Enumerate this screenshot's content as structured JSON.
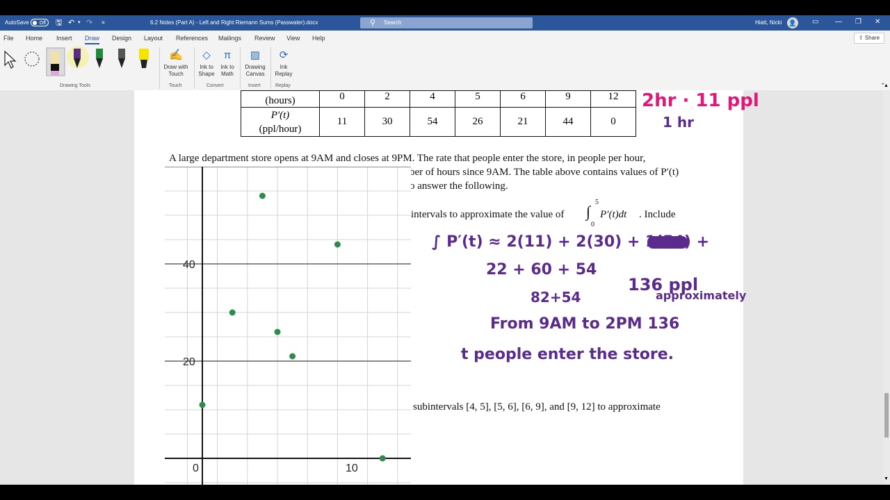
{
  "titlebar": {
    "autosave_label": "AutoSave",
    "autosave_state": "Off",
    "doc_title": "6.2 Notes (Part A) - Left and Right Riemann Sums (Passwater).docx",
    "search_placeholder": "Search",
    "user_name": "Hiatt, Nicki"
  },
  "menu": {
    "tabs": [
      "File",
      "Home",
      "Insert",
      "Draw",
      "Design",
      "Layout",
      "References",
      "Mailings",
      "Review",
      "View",
      "Help"
    ],
    "share": "Share"
  },
  "ribbon": {
    "draw_with_touch": "Draw with Touch",
    "ink_to_shape": "Ink to Shape",
    "ink_to_math": "Ink to Math",
    "drawing_canvas": "Drawing Canvas",
    "ink_replay": "Ink Replay",
    "groups": {
      "drawing_tools": "Drawing Tools",
      "touch": "Touch",
      "convert": "Convert",
      "insert": "Insert",
      "replay": "Replay"
    },
    "pen_colors": [
      "#111111",
      "#5b2a86",
      "#1f8a3a",
      "#333333",
      "#f5e400"
    ]
  },
  "table": {
    "row1_label": "(hours)",
    "row1_values": [
      "0",
      "2",
      "4",
      "5",
      "6",
      "9",
      "12"
    ],
    "row2_label_top": "P′(t)",
    "row2_label_bottom": "(ppl/hour)",
    "row2_values": [
      "11",
      "30",
      "54",
      "26",
      "21",
      "44",
      "0"
    ]
  },
  "document": {
    "para1_line1": "A large department store opens at 9AM and closes at 9PM.  The rate that people enter the store,  in people per hour,",
    "para1_line2": "ber of hours since 9AM.  The table above contains values of P′(t)",
    "para1_line3": "o answer the following.",
    "q1_text": "intervals to approximate the value of",
    "integral_upper": "5",
    "integral_lower": "0",
    "integrand": "P′(t)dt",
    "q1_suffix": ".  Include",
    "q2_text": "subintervals [4, 5], [5, 6], [6, 9], and [9, 12] to approximate"
  },
  "handwriting": {
    "margin_top": "2hr · 11 ppl",
    "margin_bottom": "1      hr",
    "line1": "∫ P′(t) ≈ 2(11) + 2(30) + 1(54) +",
    "line2": "22 + 60 + 54",
    "line3": "82+54",
    "line4": "136 ppl",
    "approx_note": "approximately",
    "line5": "From 9AM to 2PM  136",
    "line6": "t   people  enter  the  store."
  },
  "chart_data": {
    "type": "scatter",
    "x": [
      0,
      2,
      4,
      5,
      6,
      9,
      12
    ],
    "y": [
      11,
      30,
      54,
      26,
      21,
      44,
      0
    ],
    "xlim": [
      -5,
      28
    ],
    "ylim": [
      -5,
      60
    ],
    "xticks": [
      "0",
      "10"
    ],
    "yticks": [
      "20",
      "40"
    ],
    "grid": true,
    "point_color": "#2e8b4a"
  }
}
